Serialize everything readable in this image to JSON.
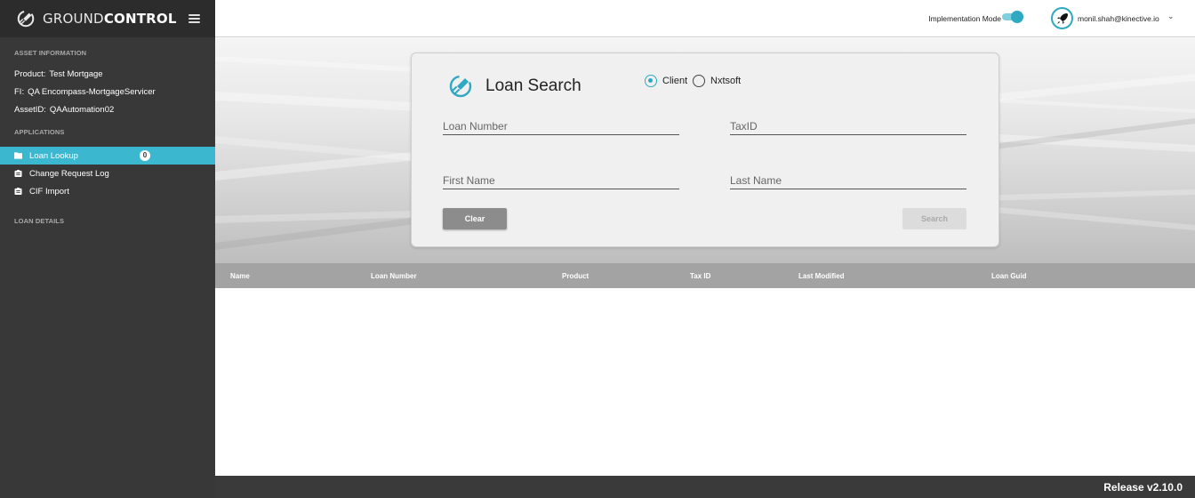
{
  "brand": {
    "name_light": "GROUND",
    "name_bold": "CONTROL"
  },
  "sidebar": {
    "asset_heading": "ASSET INFORMATION",
    "asset_info": [
      {
        "key": "Product:",
        "value": "Test Mortgage"
      },
      {
        "key": "FI:",
        "value": "QA Encompass-MortgageServicer"
      },
      {
        "key": "AssetID:",
        "value": "QAAutomation02"
      }
    ],
    "applications_heading": "APPLICATIONS",
    "applications": [
      {
        "label": "Loan Lookup",
        "icon": "folder-icon",
        "active": true,
        "badge": "0"
      },
      {
        "label": "Change Request Log",
        "icon": "clipboard-icon",
        "active": false
      },
      {
        "label": "CIF Import",
        "icon": "clipboard-icon",
        "active": false
      }
    ],
    "loan_details_heading": "LOAN DETAILS"
  },
  "topbar": {
    "implementation_mode_label": "Implementation Mode",
    "implementation_mode_on": true,
    "user_email": "monil.shah@kinective.io",
    "user_menu_icon": "chevron-down-icon"
  },
  "search": {
    "title": "Loan Search",
    "source_options": [
      "Client",
      "Nxtsoft"
    ],
    "selected_source": "Client",
    "fields": {
      "loan_number": {
        "placeholder": "Loan Number",
        "value": ""
      },
      "tax_id": {
        "placeholder": "TaxID",
        "value": ""
      },
      "first_name": {
        "placeholder": "First Name",
        "value": ""
      },
      "last_name": {
        "placeholder": "Last Name",
        "value": ""
      }
    },
    "clear_label": "Clear",
    "search_label": "Search"
  },
  "table": {
    "columns": [
      "Name",
      "Loan Number",
      "Product",
      "Tax ID",
      "Last Modified",
      "Loan Guid"
    ],
    "rows": []
  },
  "footer": {
    "release": "Release v2.10.0"
  },
  "colors": {
    "accent": "#3bb8cf",
    "sidebar_bg": "#383838",
    "header_bg": "#a3a3a3"
  }
}
